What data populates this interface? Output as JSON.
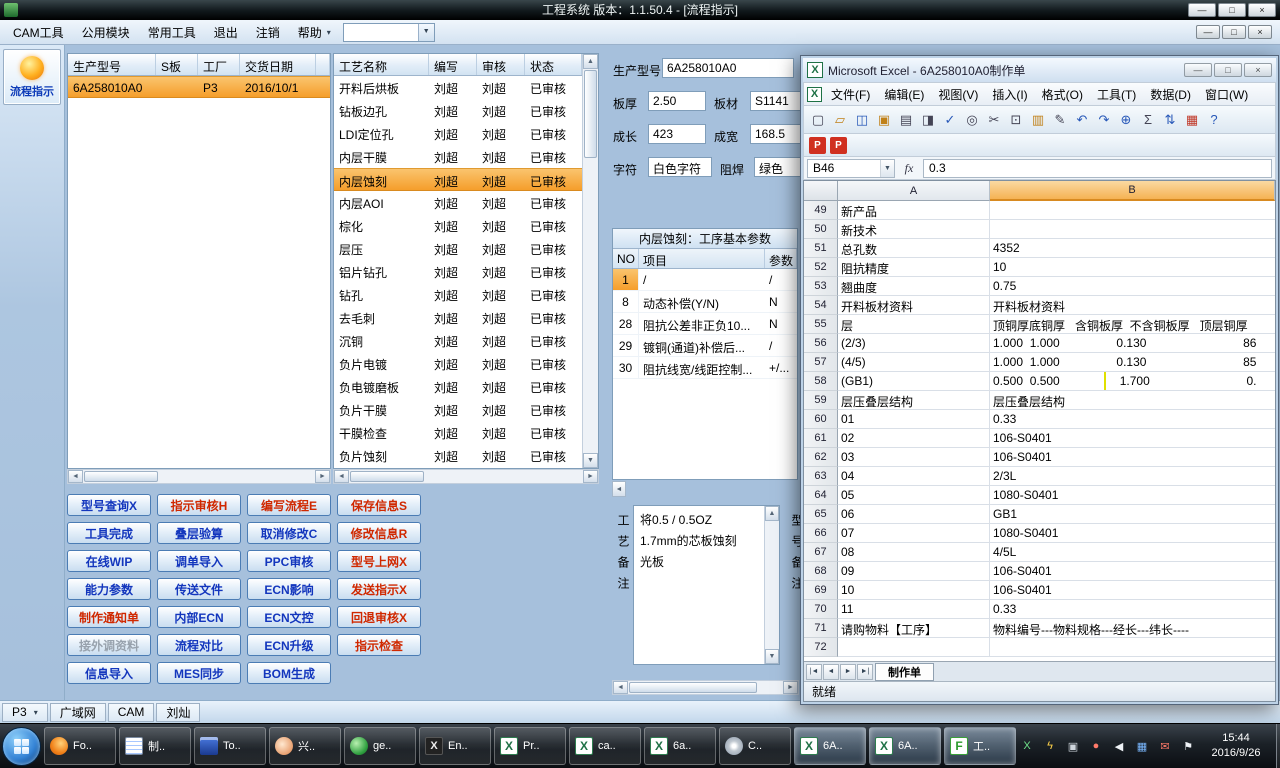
{
  "app": {
    "title": "工程系统  版本：1.1.50.4 - [流程指示]",
    "window_controls": [
      {
        "glyph": "—",
        "name": "minimize-button"
      },
      {
        "glyph": "□",
        "name": "maximize-button"
      },
      {
        "glyph": "×",
        "name": "close-button"
      }
    ]
  },
  "menubar": {
    "items": [
      "CAM工具",
      "公用模块",
      "常用工具",
      "退出",
      "注销",
      "帮助"
    ],
    "combo_value": ""
  },
  "sidebar": {
    "flow_label": "流程指示"
  },
  "production_table": {
    "headers": [
      "生产型号",
      "S板",
      "工厂",
      "交货日期"
    ],
    "row": {
      "model": "6A258010A0",
      "sboard": "",
      "factory": "P3",
      "date": "2016/10/1"
    }
  },
  "process_table": {
    "headers": [
      "工艺名称",
      "编写",
      "审核",
      "状态"
    ],
    "rows": [
      {
        "n": "开料后烘板",
        "w": "刘超",
        "a": "刘超",
        "s": "已审核",
        "st": ""
      },
      {
        "n": "钻板边孔",
        "w": "刘超",
        "a": "刘超",
        "s": "已审核",
        "st": ""
      },
      {
        "n": "LDI定位孔",
        "w": "刘超",
        "a": "刘超",
        "s": "已审核",
        "st": ""
      },
      {
        "n": "内层干膜",
        "w": "刘超",
        "a": "刘超",
        "s": "已审核",
        "st": ""
      },
      {
        "n": "内层蚀刻",
        "w": "刘超",
        "a": "刘超",
        "s": "已审核",
        "st": "selected"
      },
      {
        "n": "内层AOI",
        "w": "刘超",
        "a": "刘超",
        "s": "已审核",
        "st": ""
      },
      {
        "n": "棕化",
        "w": "刘超",
        "a": "刘超",
        "s": "已审核",
        "st": ""
      },
      {
        "n": "层压",
        "w": "刘超",
        "a": "刘超",
        "s": "已审核",
        "st": ""
      },
      {
        "n": "铝片钻孔",
        "w": "刘超",
        "a": "刘超",
        "s": "已审核",
        "st": ""
      },
      {
        "n": "钻孔",
        "w": "刘超",
        "a": "刘超",
        "s": "已审核",
        "st": ""
      },
      {
        "n": "去毛刺",
        "w": "刘超",
        "a": "刘超",
        "s": "已审核",
        "st": ""
      },
      {
        "n": "沉铜",
        "w": "刘超",
        "a": "刘超",
        "s": "已审核",
        "st": ""
      },
      {
        "n": "负片电镀",
        "w": "刘超",
        "a": "刘超",
        "s": "已审核",
        "st": ""
      },
      {
        "n": "负电镀磨板",
        "w": "刘超",
        "a": "刘超",
        "s": "已审核",
        "st": ""
      },
      {
        "n": "负片干膜",
        "w": "刘超",
        "a": "刘超",
        "s": "已审核",
        "st": ""
      },
      {
        "n": "干膜检查",
        "w": "刘超",
        "a": "刘超",
        "s": "已审核",
        "st": ""
      },
      {
        "n": "负片蚀刻",
        "w": "刘超",
        "a": "刘超",
        "s": "已审核",
        "st": ""
      }
    ]
  },
  "action_buttons": [
    {
      "label": "型号查询X",
      "color": "blue"
    },
    {
      "label": "指示审核H",
      "color": "red"
    },
    {
      "label": "编写流程E",
      "color": "red"
    },
    {
      "label": "保存信息S",
      "color": "red"
    },
    {
      "label": "工具完成",
      "color": "blue"
    },
    {
      "label": "叠层验算",
      "color": "blue"
    },
    {
      "label": "取消修改C",
      "color": "blue"
    },
    {
      "label": "修改信息R",
      "color": "red"
    },
    {
      "label": "在线WIP",
      "color": "blue"
    },
    {
      "label": "调单导入",
      "color": "blue"
    },
    {
      "label": "PPC审核",
      "color": "blue"
    },
    {
      "label": "型号上网X",
      "color": "red"
    },
    {
      "label": "能力参数",
      "color": "blue"
    },
    {
      "label": "传送文件",
      "color": "blue"
    },
    {
      "label": "ECN影响",
      "color": "blue"
    },
    {
      "label": "发送指示X",
      "color": "red"
    },
    {
      "label": "制作通知单",
      "color": "red"
    },
    {
      "label": "内部ECN",
      "color": "blue"
    },
    {
      "label": "ECN文控",
      "color": "blue"
    },
    {
      "label": "回退审核X",
      "color": "red"
    },
    {
      "label": "接外调资料",
      "color": "gray"
    },
    {
      "label": "流程对比",
      "color": "blue"
    },
    {
      "label": "ECN升级",
      "color": "blue"
    },
    {
      "label": "指示检查",
      "color": "red"
    },
    {
      "label": "信息导入",
      "color": "blue"
    },
    {
      "label": "MES同步",
      "color": "blue"
    },
    {
      "label": "BOM生成",
      "color": "blue"
    }
  ],
  "info": {
    "model_label": "生产型号",
    "model": "6A258010A0",
    "thickness_label": "板厚",
    "thickness": "2.50",
    "material_label": "板材",
    "material": "S1141",
    "length_label": "成长",
    "length": "423",
    "width_label": "成宽",
    "width": "168.5",
    "legend_label": "字符",
    "legend": "白色字符",
    "mask_label": "阻焊",
    "mask": "绿色"
  },
  "params_table": {
    "title": "内层蚀刻：工序基本参数",
    "headers": [
      "NO",
      "项目",
      "参数"
    ],
    "rows": [
      {
        "no": "1",
        "item": "/",
        "value": "/",
        "state": "selected"
      },
      {
        "no": "8",
        "item": "动态补偿(Y/N)",
        "value": "N",
        "state": ""
      },
      {
        "no": "28",
        "item": "阻抗公差非正负10...",
        "value": "N",
        "state": ""
      },
      {
        "no": "29",
        "item": "镀铜(通道)补偿后...",
        "value": "/",
        "state": ""
      },
      {
        "no": "30",
        "item": "阻抗线宽/线距控制...",
        "value": "+/...",
        "state": ""
      }
    ]
  },
  "notes": {
    "label": "工艺备注",
    "side_label": "型号备注",
    "lines": [
      "将0.5 / 0.5OZ",
      "1.7mm的芯板蚀刻",
      "光板"
    ]
  },
  "app_statusbar": {
    "site": "P3",
    "items": [
      "广域网",
      "CAM",
      "刘灿"
    ]
  },
  "excel": {
    "title": "Microsoft Excel - 6A258010A0制作单",
    "menu": [
      "文件(F)",
      "编辑(E)",
      "视图(V)",
      "插入(I)",
      "格式(O)",
      "工具(T)",
      "数据(D)",
      "窗口(W)"
    ],
    "toolbar_icons": [
      {
        "name": "new-icon",
        "glyph": "▢",
        "cls": "g-dark"
      },
      {
        "name": "open-icon",
        "glyph": "▱",
        "cls": "g-amber"
      },
      {
        "name": "save-icon",
        "glyph": "◫",
        "cls": "g-blue"
      },
      {
        "name": "permission-icon",
        "glyph": "▣",
        "cls": "g-amber"
      },
      {
        "name": "print-icon",
        "glyph": "▤",
        "cls": "g-dark"
      },
      {
        "name": "preview-icon",
        "glyph": "◨",
        "cls": "g-dark"
      },
      {
        "name": "spelling-icon",
        "glyph": "✓",
        "cls": "g-blue"
      },
      {
        "name": "research-icon",
        "glyph": "◎",
        "cls": "g-dark"
      },
      {
        "name": "cut-icon",
        "glyph": "✂",
        "cls": "g-dark"
      },
      {
        "name": "copy-icon",
        "glyph": "⊡",
        "cls": "g-dark"
      },
      {
        "name": "paste-icon",
        "glyph": "▥",
        "cls": "g-amber"
      },
      {
        "name": "format-painter-icon",
        "glyph": "✎",
        "cls": "g-dark"
      },
      {
        "name": "undo-icon",
        "glyph": "↶",
        "cls": "g-blue"
      },
      {
        "name": "redo-icon",
        "glyph": "↷",
        "cls": "g-blue"
      },
      {
        "name": "hyperlink-icon",
        "glyph": "⊕",
        "cls": "g-blue"
      },
      {
        "name": "autosum-icon",
        "glyph": "Σ",
        "cls": "g-dark"
      },
      {
        "name": "sort-asc-icon",
        "glyph": "⇅",
        "cls": "g-blue"
      },
      {
        "name": "chart-wizard-icon",
        "glyph": "▦",
        "cls": "g-red"
      },
      {
        "name": "help-icon",
        "glyph": "?",
        "cls": "g-blue"
      }
    ],
    "addin_icons": [
      {
        "name": "pdf-create-icon",
        "glyph": "P",
        "cls": "g-redfill"
      },
      {
        "name": "pdf-batch-icon",
        "glyph": "P",
        "cls": "g-redfill"
      }
    ],
    "name_box": "B46",
    "fx_label": "fx",
    "formula_value": "0.3",
    "columns": [
      "A",
      "B"
    ],
    "rows": [
      {
        "n": "49",
        "a": "新产品",
        "b": "",
        "hl": ""
      },
      {
        "n": "50",
        "a": "新技术",
        "b": "",
        "hl": ""
      },
      {
        "n": "51",
        "a": "总孔数",
        "b": "4352",
        "hl": ""
      },
      {
        "n": "52",
        "a": "阻抗精度",
        "b": "10",
        "hl": ""
      },
      {
        "n": "53",
        "a": "翘曲度",
        "b": "0.75",
        "hl": ""
      },
      {
        "n": "54",
        "a": "开料板材资料",
        "b": "开料板材资料",
        "hl": ""
      },
      {
        "n": "55",
        "a": "层",
        "b": "顶铜厚底铜厚   含铜板厚  不含铜板厚   顶层铜厚",
        "hl": ""
      },
      {
        "n": "56",
        "a": "(2/3)",
        "b": "1.000  1.000                 0.130                             86",
        "hl": ""
      },
      {
        "n": "57",
        "a": "(4/5)",
        "b": "1.000  1.000                 0.130                             85",
        "hl": ""
      },
      {
        "n": "58",
        "a": "(GB1)",
        "b": "0.500  0.500                  1.700                             0.",
        "hl": "hl"
      },
      {
        "n": "59",
        "a": "层压叠层结构",
        "b": "层压叠层结构",
        "hl": ""
      },
      {
        "n": "60",
        "a": "01",
        "b": "0.33",
        "hl": ""
      },
      {
        "n": "61",
        "a": "02",
        "b": "106-S0401",
        "hl": ""
      },
      {
        "n": "62",
        "a": "03",
        "b": "106-S0401",
        "hl": ""
      },
      {
        "n": "63",
        "a": "04",
        "b": "2/3L",
        "hl": ""
      },
      {
        "n": "64",
        "a": "05",
        "b": "1080-S0401",
        "hl": ""
      },
      {
        "n": "65",
        "a": "06",
        "b": "GB1",
        "hl": ""
      },
      {
        "n": "66",
        "a": "07",
        "b": "1080-S0401",
        "hl": ""
      },
      {
        "n": "67",
        "a": "08",
        "b": "4/5L",
        "hl": ""
      },
      {
        "n": "68",
        "a": "09",
        "b": "106-S0401",
        "hl": ""
      },
      {
        "n": "69",
        "a": "10",
        "b": "106-S0401",
        "hl": ""
      },
      {
        "n": "70",
        "a": "11",
        "b": "0.33",
        "hl": ""
      },
      {
        "n": "71",
        "a": "请购物料【工序】",
        "b": "物料编号---物料规格---经长---纬长----",
        "hl": ""
      },
      {
        "n": "72",
        "a": "",
        "b": "",
        "hl": ""
      }
    ],
    "sheet_nav": [
      "|◄",
      "◄",
      "►",
      "►|"
    ],
    "sheet_tab": "制作单",
    "status": "就绪"
  },
  "taskbar": {
    "items": [
      {
        "label": "Fo..",
        "icon": "firefox-icon",
        "state": ""
      },
      {
        "label": "制..",
        "icon": "doc-icon",
        "state": ""
      },
      {
        "label": "To..",
        "icon": "disk-icon",
        "state": ""
      },
      {
        "label": "兴..",
        "icon": "shell-icon",
        "state": ""
      },
      {
        "label": "ge..",
        "icon": "globe-icon",
        "state": ""
      },
      {
        "label": "En..",
        "icon": "xdark-icon",
        "state": ""
      },
      {
        "label": "Pr..",
        "icon": "excel-doc-icon",
        "state": ""
      },
      {
        "label": "ca..",
        "icon": "excel-doc-icon",
        "state": ""
      },
      {
        "label": "6a..",
        "icon": "excel-doc-icon",
        "state": ""
      },
      {
        "label": "C..",
        "icon": "cd-icon",
        "state": ""
      },
      {
        "label": "6A..",
        "icon": "excel-doc-icon",
        "state": "active"
      },
      {
        "label": "6A..",
        "icon": "excel-doc-icon",
        "state": "active"
      },
      {
        "label": "工..",
        "icon": "foxmail-icon",
        "state": "active"
      }
    ],
    "tray_icons": [
      {
        "name": "excel-tray-icon",
        "glyph": "X",
        "cls": "t-green"
      },
      {
        "name": "flash-icon",
        "glyph": "ϟ",
        "cls": "t-amber"
      },
      {
        "name": "window-icon",
        "glyph": "▣",
        "cls": "t-gray"
      },
      {
        "name": "security-icon",
        "glyph": "●",
        "cls": "t-red"
      },
      {
        "name": "volume-icon",
        "glyph": "◀",
        "cls": "t-white"
      },
      {
        "name": "network-icon",
        "glyph": "▦",
        "cls": "t-blue"
      },
      {
        "name": "mail-icon",
        "glyph": "✉",
        "cls": "t-red"
      },
      {
        "name": "flag-icon",
        "glyph": "⚑",
        "cls": "t-white"
      }
    ],
    "clock": {
      "time": "15:44",
      "date": "2016/9/26"
    }
  }
}
